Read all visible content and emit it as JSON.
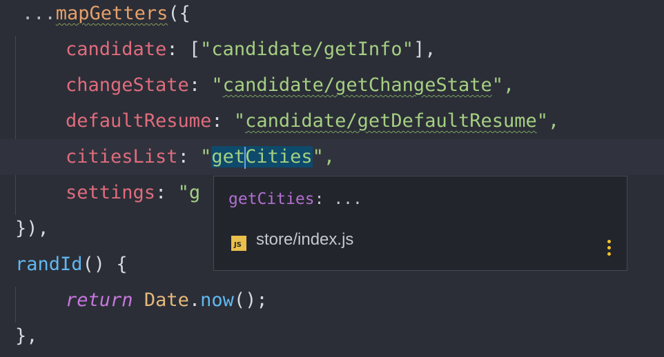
{
  "code": {
    "line1": {
      "ellipsis": "...",
      "fn": "mapGetters",
      "punc": "({"
    },
    "line2": {
      "key": "candidate",
      "colon": ":",
      "open": " [",
      "str": "\"candidate/getInfo\"",
      "close": "],"
    },
    "line3": {
      "key": "changeState",
      "colon": ":",
      "q1": " \"",
      "str": "candidate/getChangeState",
      "q2": "\","
    },
    "line4": {
      "key": "defaultResume",
      "colon": ":",
      "q1": " \"",
      "str": "candidate/getDefaultResume",
      "q2": "\","
    },
    "line5": {
      "key": "citiesList",
      "colon": ":",
      "q1": " \"",
      "sel_before": "get",
      "sel_after": "Cities",
      "q2": "\","
    },
    "line6": {
      "key": "settings",
      "colon": ":",
      "q1": " \"",
      "str": "g"
    },
    "line7": {
      "text": "}),"
    },
    "line8": {
      "ident": "randId",
      "punc": "() {"
    },
    "line9": {
      "kw": "return",
      "type": "Date",
      "dot": ".",
      "method": "now",
      "punc": "();"
    },
    "line10": {
      "text": "},"
    }
  },
  "popup": {
    "signature_name": "getCities",
    "signature_rest": ": ...",
    "file_icon": "JS",
    "file_path": "store/index.js"
  },
  "colors": {
    "background": "#2b2e37",
    "key": "#e06c7d",
    "string": "#a5cf82",
    "function": "#e6a06a",
    "selection": "#0e4a6b",
    "more_icon": "#f4c329"
  }
}
